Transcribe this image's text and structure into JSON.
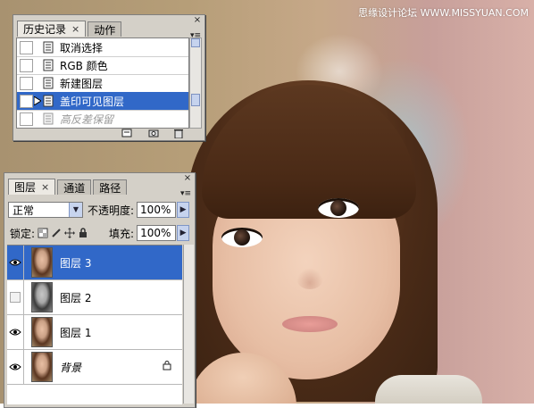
{
  "watermark": "思缘设计论坛 WWW.MISSYUAN.COM",
  "history_panel": {
    "tabs": [
      {
        "label": "历史记录",
        "close": "×"
      },
      {
        "label": "动作"
      }
    ],
    "close_glyph": "×",
    "menu_glyph": "▾≡",
    "items": [
      {
        "label": "取消选择"
      },
      {
        "label": "RGB 颜色"
      },
      {
        "label": "新建图层"
      },
      {
        "label": "盖印可见图层"
      },
      {
        "label": "高反差保留"
      }
    ],
    "selected_index": 3,
    "footer_icons": [
      "new-document-icon",
      "camera-icon",
      "trash-icon"
    ]
  },
  "layers_panel": {
    "tabs": [
      {
        "label": "图层",
        "close": "×"
      },
      {
        "label": "通道"
      },
      {
        "label": "路径"
      }
    ],
    "close_glyph": "×",
    "menu_glyph": "▾≡",
    "blend_mode": "正常",
    "opacity_label": "不透明度:",
    "opacity_value": "100%",
    "lock_label": "锁定:",
    "fill_label": "填充:",
    "fill_value": "100%",
    "layers": [
      {
        "name": "图层 3",
        "visible": true,
        "selected": true
      },
      {
        "name": "图层 2",
        "visible": false,
        "selected": false
      },
      {
        "name": "图层 1",
        "visible": true,
        "selected": false
      },
      {
        "name": "背景",
        "visible": true,
        "selected": false,
        "locked": true
      }
    ]
  }
}
